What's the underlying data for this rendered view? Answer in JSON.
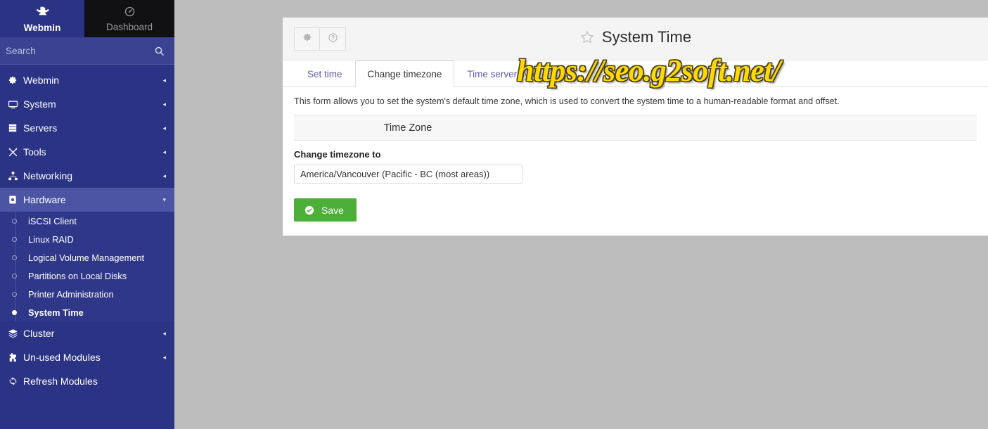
{
  "sidebar": {
    "brand": {
      "label": "Webmin",
      "icon": "webmin-logo-icon"
    },
    "dashboard": {
      "label": "Dashboard",
      "icon": "dashboard-gauge-icon"
    },
    "search": {
      "placeholder": "Search",
      "value": "",
      "icon": "search-icon"
    },
    "nav": [
      {
        "label": "Webmin",
        "icon": "gear-icon",
        "caret": "◂",
        "active": false
      },
      {
        "label": "System",
        "icon": "monitor-icon",
        "caret": "◂",
        "active": false
      },
      {
        "label": "Servers",
        "icon": "server-icon",
        "caret": "◂",
        "active": false
      },
      {
        "label": "Tools",
        "icon": "tools-icon",
        "caret": "◂",
        "active": false
      },
      {
        "label": "Networking",
        "icon": "network-icon",
        "caret": "◂",
        "active": false
      },
      {
        "label": "Hardware",
        "icon": "hardware-icon",
        "caret": "▾",
        "active": true
      }
    ],
    "submenu": [
      {
        "label": "iSCSI Client",
        "active": false
      },
      {
        "label": "Linux RAID",
        "active": false
      },
      {
        "label": "Logical Volume Management",
        "active": false
      },
      {
        "label": "Partitions on Local Disks",
        "active": false
      },
      {
        "label": "Printer Administration",
        "active": false
      },
      {
        "label": "System Time",
        "active": true
      }
    ],
    "nav_bottom": [
      {
        "label": "Cluster",
        "icon": "layers-icon",
        "caret": "◂",
        "active": false
      },
      {
        "label": "Un-used Modules",
        "icon": "puzzle-icon",
        "caret": "◂",
        "active": false
      },
      {
        "label": "Refresh Modules",
        "icon": "refresh-icon",
        "caret": "",
        "active": false
      }
    ]
  },
  "panel": {
    "title": "System Time",
    "star_icon": "star-outline-icon",
    "toolbar": {
      "gear_button": "gear-icon",
      "help_button": "help-circle-icon"
    },
    "tabs": [
      {
        "label": "Set time",
        "active": false
      },
      {
        "label": "Change timezone",
        "active": true
      },
      {
        "label": "Time server sync",
        "active": false
      }
    ],
    "form": {
      "description": "This form allows you to set the system's default time zone, which is used to convert the system time to a human-readable format and offset.",
      "section_header": "Time Zone",
      "field_label": "Change timezone to",
      "timezone_value": "America/Vancouver (Pacific - BC (most areas))",
      "save_label": "Save",
      "save_icon": "check-circle-icon"
    }
  },
  "watermark": {
    "text": "https://seo.g2soft.net/"
  },
  "colors": {
    "sidebar_bg": "#2b3384",
    "sidebar_active": "#4c55a4",
    "search_bg": "#3a4291",
    "dashboard_bg": "#111113",
    "page_bg": "#bdbdbd",
    "panel_bg": "#ffffff",
    "tab_link": "#5d5fa8",
    "save_green": "#4caf37",
    "watermark_yellow": "#ffd900"
  }
}
